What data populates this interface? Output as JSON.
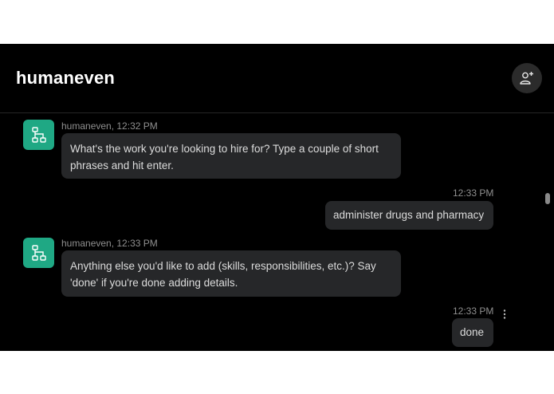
{
  "header": {
    "title": "humaneven",
    "add_user_icon": "add-user-icon"
  },
  "messages": [
    {
      "sender": "humaneven",
      "meta": "humaneven, 12:32 PM",
      "text": "What's the work you're looking to hire for? Type a couple of short phrases and hit enter."
    },
    {
      "sender": "user",
      "time": "12:33 PM",
      "text": "administer drugs and pharmacy"
    },
    {
      "sender": "humaneven",
      "meta": "humaneven, 12:33 PM",
      "text": "Anything else you'd like to add (skills, responsibilities, etc.)? Say 'done' if you're done adding details."
    },
    {
      "sender": "user",
      "time": "12:33 PM",
      "text": "done"
    }
  ],
  "colors": {
    "background": "#000000",
    "bubble": "#262729",
    "avatar": "#1fa884",
    "meta_text": "#8f8f8f"
  }
}
